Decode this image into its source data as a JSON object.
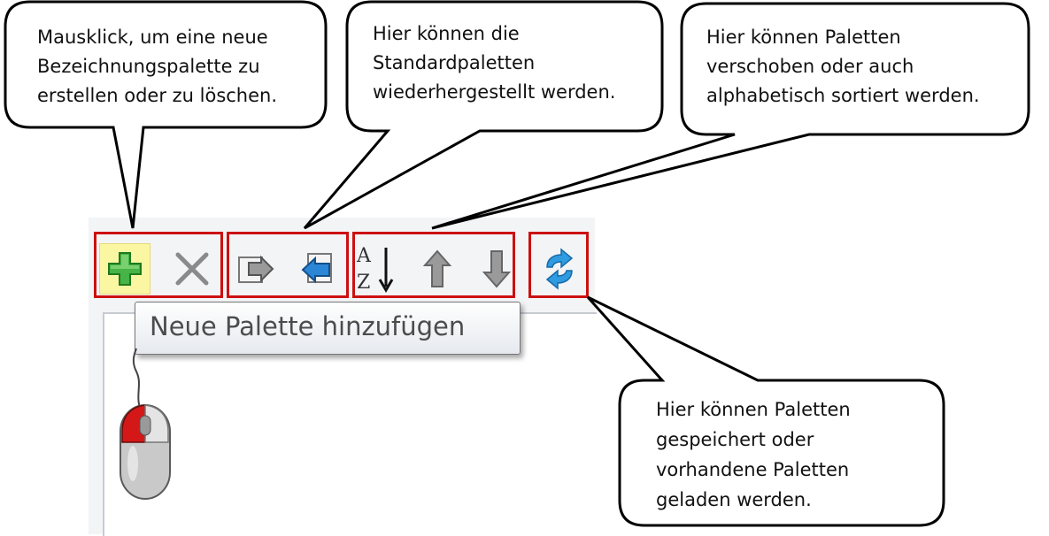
{
  "callouts": {
    "add": {
      "lines": [
        "Mausklick, um eine neue",
        "Bezeichnungspalette zu",
        "erstellen oder zu löschen."
      ]
    },
    "standard": {
      "lines": [
        "Hier können die",
        "Standardpaletten",
        "wiederhergestellt werden."
      ]
    },
    "move": {
      "lines": [
        "Hier können Paletten",
        "verschoben oder auch",
        "alphabetisch sortiert werden."
      ]
    },
    "save": {
      "lines": [
        "Hier können Paletten",
        "gespeichert oder",
        "vorhandene Paletten",
        "geladen werden."
      ]
    }
  },
  "tooltip": {
    "text": "Neue Palette hinzufügen"
  },
  "toolbar": {
    "buttons": [
      {
        "icon": "plus-icon",
        "title": "Neue Palette hinzufügen"
      },
      {
        "icon": "delete-icon"
      },
      {
        "icon": "export-icon"
      },
      {
        "icon": "import-icon"
      },
      {
        "icon": "sort-az-icon"
      },
      {
        "icon": "arrow-up-icon"
      },
      {
        "icon": "arrow-down-icon"
      },
      {
        "icon": "refresh-icon"
      }
    ]
  },
  "colors": {
    "highlight_box": "#cc1010",
    "hover_background": "#fbf6a2",
    "plus_green": "#3aa63a",
    "import_blue": "#2b86d6",
    "mouse_red": "#d41818"
  }
}
